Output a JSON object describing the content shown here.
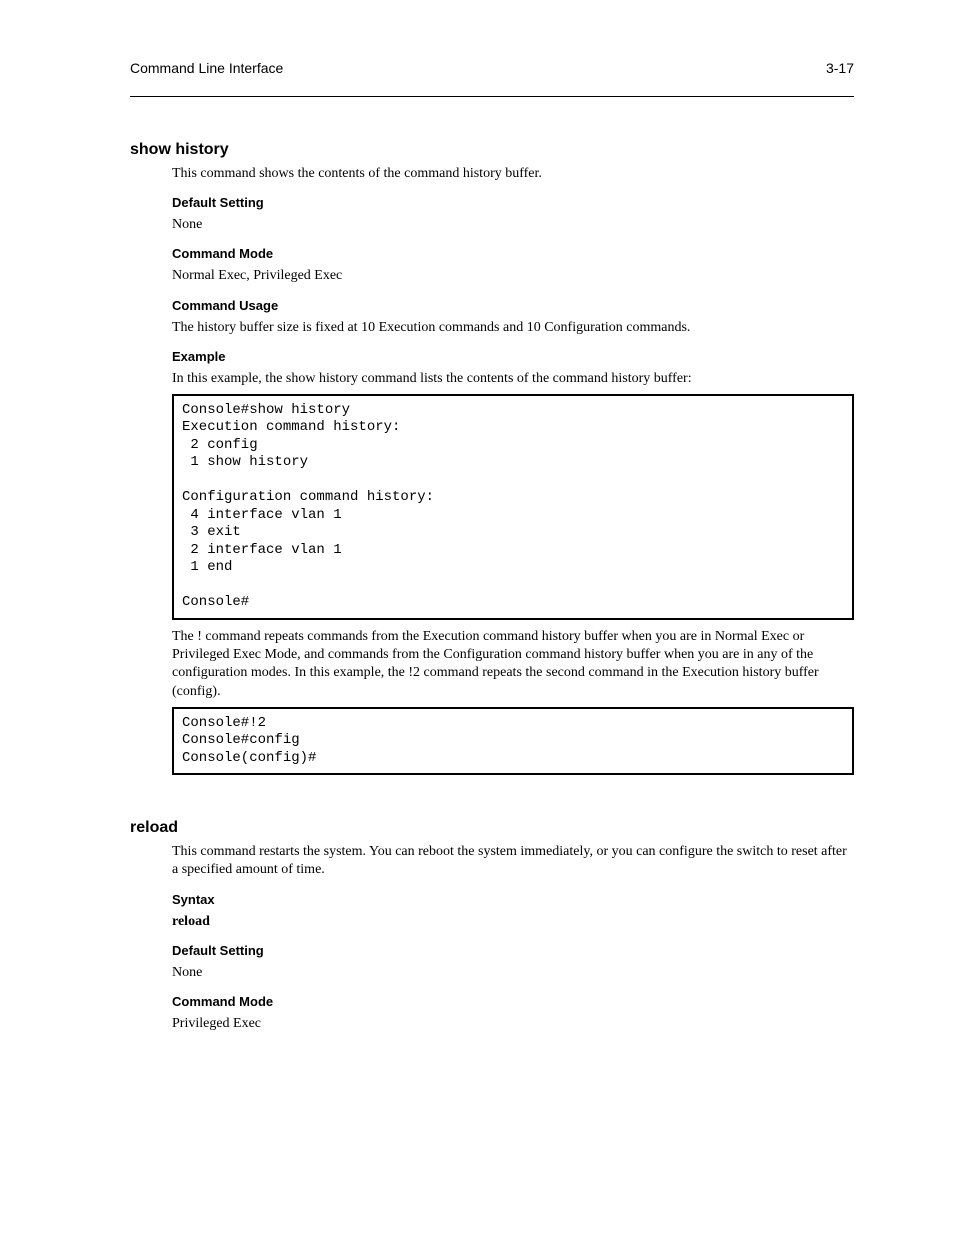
{
  "header": {
    "left": "Command Line Interface",
    "right": "3-17"
  },
  "section1": {
    "title": "show history",
    "desc": "This command shows the contents of the command history buffer.",
    "defaultHead": "Default Setting",
    "defaultText": "None",
    "modeHead": "Command Mode",
    "modeText": "Normal Exec, Privileged Exec",
    "usageHead": "Command Usage",
    "usageText": "The history buffer size is fixed at 10 Execution commands and 10 Configuration commands.",
    "exampleHead": "Example",
    "exampleIntro": "In this example, the show history command lists the contents of the command history buffer:",
    "terminal": "Console#show history\nExecution command history:\n 2 config\n 1 show history\n\nConfiguration command history:\n 4 interface vlan 1\n 3 exit\n 2 interface vlan 1\n 1 end\n\nConsole#",
    "repeatPara": "The ! command repeats commands from the Execution command history buffer when you are in Normal Exec or Privileged Exec Mode, and commands from the Configuration command history buffer when you are in any of the configuration modes. In this example, the !2 command repeats the second command in the Execution history buffer (config).",
    "terminal2": "Console#!2\nConsole#config\nConsole(config)#"
  },
  "section2": {
    "title": "reload",
    "desc": "This command restarts the system. You can reboot the system immediately, or you can configure the switch to reset after a specified amount of time.",
    "syntaxHead": "Syntax",
    "syntaxLines": "reload",
    "defaultHead": "Default Setting",
    "defaultText": "None",
    "modeHead": "Command Mode",
    "modeText": "Privileged Exec"
  },
  "footer": {
    "left": "",
    "right": ""
  }
}
